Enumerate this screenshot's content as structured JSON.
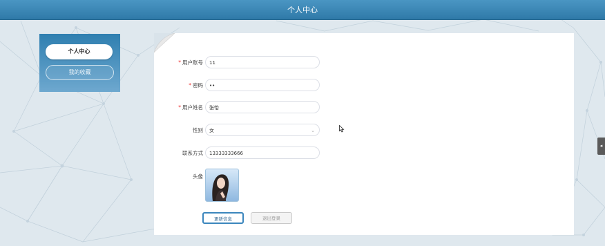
{
  "header": {
    "title": "个人中心"
  },
  "sidebar": {
    "items": [
      {
        "label": "个人中心",
        "active": true
      },
      {
        "label": "我的收藏",
        "active": false
      }
    ]
  },
  "form": {
    "fields": [
      {
        "label": "用户账号",
        "required": true,
        "value": "11"
      },
      {
        "label": "密码",
        "required": true,
        "value": "••"
      },
      {
        "label": "用户姓名",
        "required": true,
        "value": "张怡"
      },
      {
        "label": "性别",
        "required": false,
        "value": "女",
        "type": "select"
      },
      {
        "label": "联系方式",
        "required": false,
        "value": "13333333666"
      }
    ],
    "avatar_label": "头像",
    "required_mark": "*"
  },
  "buttons": {
    "update": "更新信息",
    "logout": "退出登录"
  },
  "colors": {
    "header_bg": "#2f79a8",
    "sidebar_bg": "#2f7fb0",
    "required": "#e33333",
    "primary_border": "#3b86bd"
  },
  "icons": {
    "select": "chevron-down-icon",
    "side_tab": "chevron-left-icon"
  }
}
